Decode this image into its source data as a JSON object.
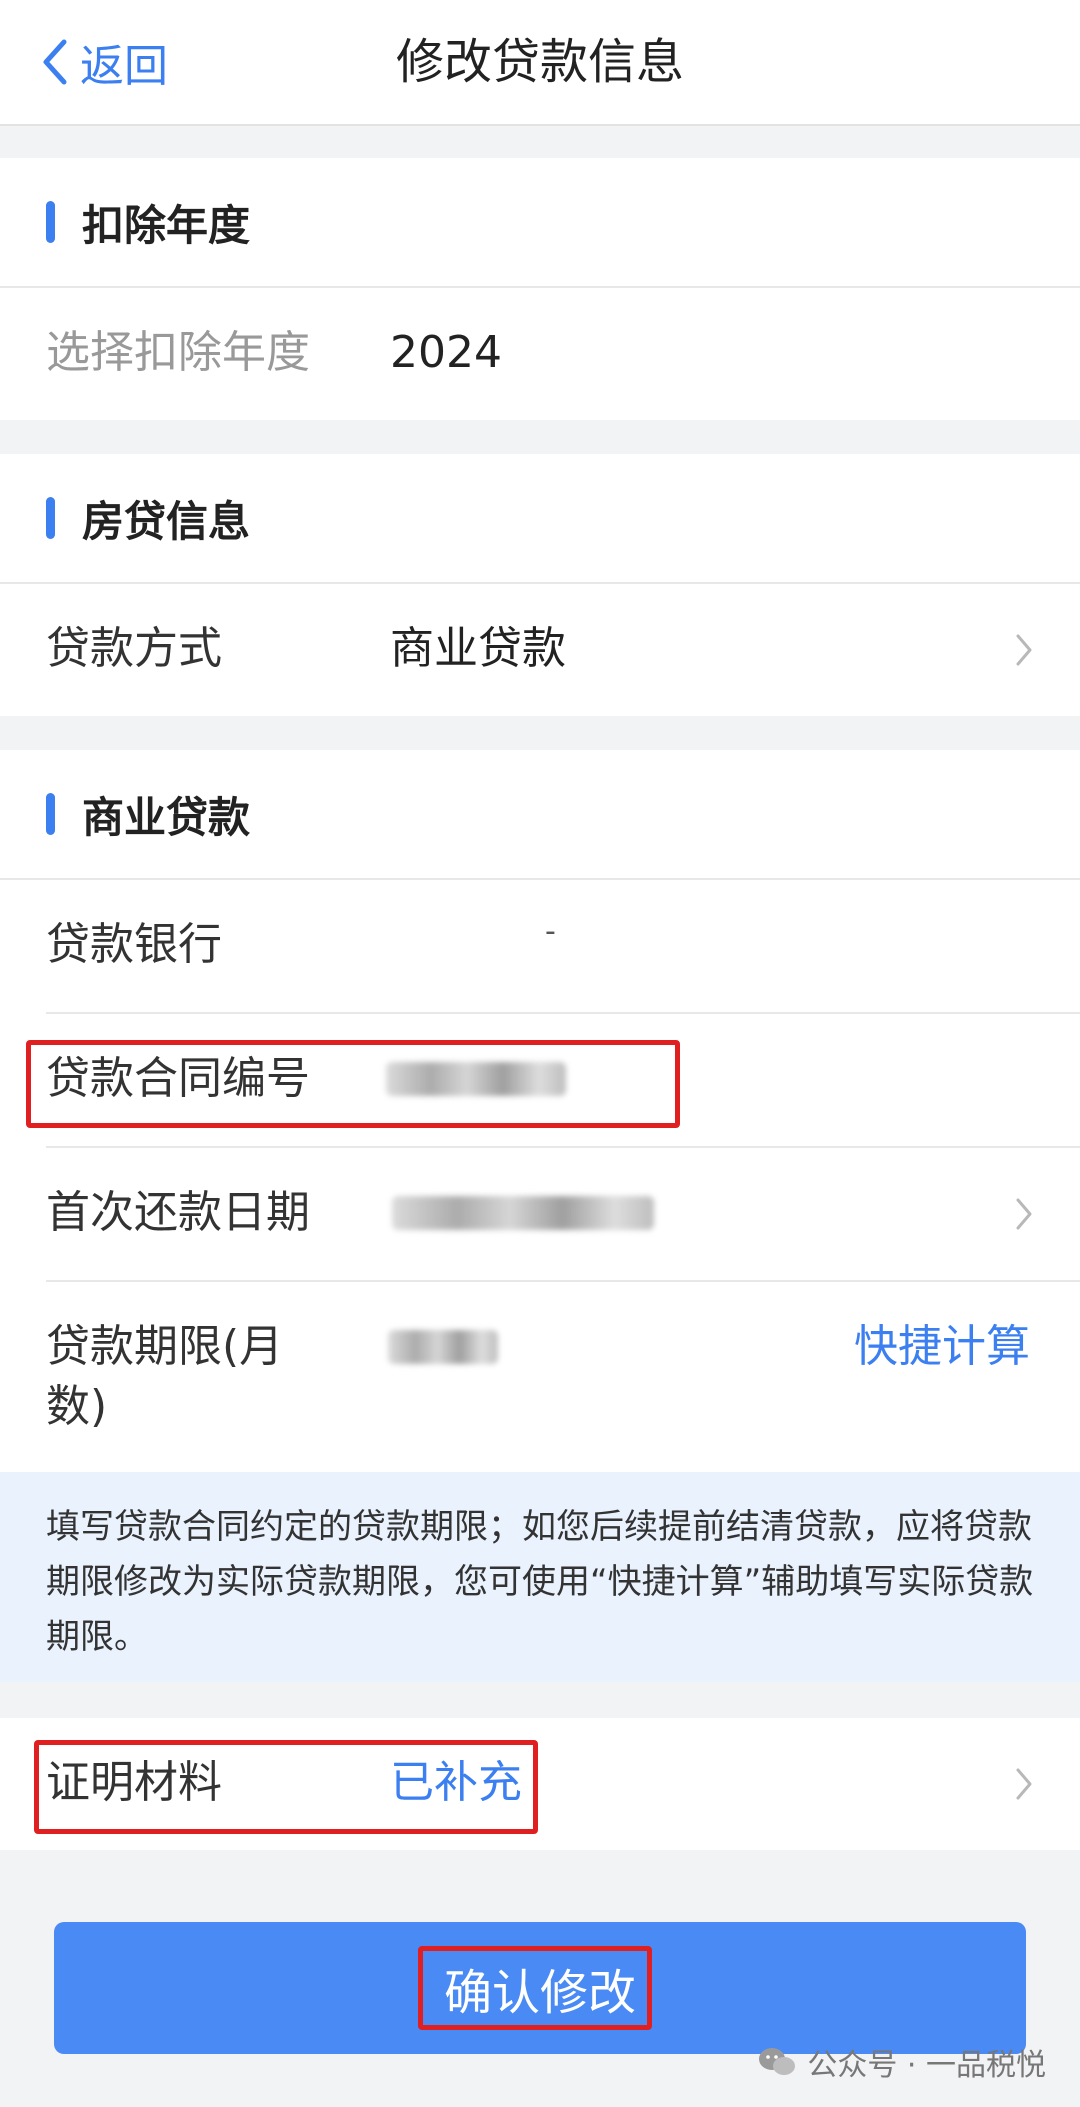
{
  "nav": {
    "back_label": "返回",
    "title": "修改贷款信息"
  },
  "sections": {
    "deduction_year": {
      "title": "扣除年度",
      "select_label": "选择扣除年度",
      "select_value": "2024"
    },
    "mortgage_info": {
      "title": "房贷信息",
      "method_label": "贷款方式",
      "method_value": "商业贷款"
    },
    "commercial_loan": {
      "title": "商业贷款",
      "bank_label": "贷款银行",
      "bank_value": "-",
      "contract_label": "贷款合同编号",
      "first_date_label": "首次还款日期",
      "term_label_line1": "贷款期限(月",
      "term_label_line2": "数)",
      "quick_calc_label": "快捷计算"
    }
  },
  "hint": {
    "text": "填写贷款合同约定的贷款期限；如您后续提前结清贷款，应将贷款期限修改为实际贷款期限，您可使用“快捷计算”辅助填写实际贷款期限。"
  },
  "proof": {
    "label": "证明材料",
    "status": "已补充"
  },
  "confirm_label": "确认修改",
  "watermark": "公众号 · 一品税悦",
  "colors": {
    "accent": "#3c7ff0",
    "button": "#4a8af4",
    "highlight_box": "#e02020",
    "hint_bg": "#eaf2fd"
  }
}
